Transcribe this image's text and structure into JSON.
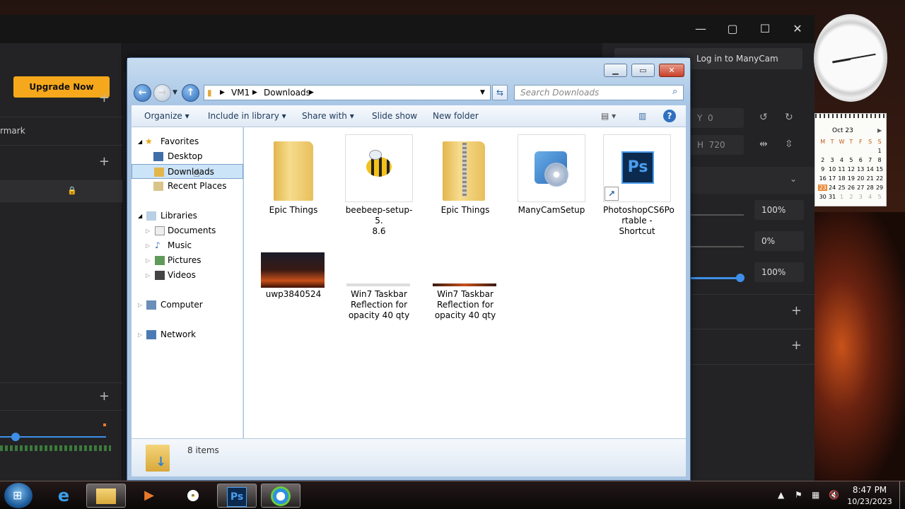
{
  "manycam": {
    "upgrade_label": "Upgrade Now",
    "left_partial_label": "rmark",
    "login_label": "Log in to ManyCam",
    "field_x": "0",
    "field_h": "720",
    "field_top": "720",
    "pct_1": "100%",
    "pct_2": "0%",
    "pct_3": "100%",
    "field_x_letter": "Y",
    "field_h_letter": "H",
    "plus": "+",
    "minimize": "—",
    "restore": "▢",
    "maximize": "☐",
    "close": "✕"
  },
  "explorer": {
    "breadcrumb": [
      "VM1",
      "Downloads"
    ],
    "search_placeholder": "Search Downloads",
    "commands": [
      "Organize",
      "Include in library",
      "Share with",
      "Slide show",
      "New folder"
    ],
    "nav": {
      "favorites": "Favorites",
      "desktop": "Desktop",
      "downloads": "Downloads",
      "recent": "Recent Places",
      "libraries": "Libraries",
      "documents": "Documents",
      "music": "Music",
      "pictures": "Pictures",
      "videos": "Videos",
      "computer": "Computer",
      "network": "Network"
    },
    "files": [
      {
        "name": "Epic Things",
        "icon": "folder-icon"
      },
      {
        "name": "beebeep-setup-5.\n8.6",
        "icon": "bee-icon"
      },
      {
        "name": "Epic Things",
        "icon": "zip-folder-icon"
      },
      {
        "name": "ManyCamSetup",
        "icon": "installer-icon"
      },
      {
        "name": "PhotoshopCS6Po\nrtable - Shortcut",
        "icon": "photoshop-icon"
      },
      {
        "name": "uwp3840524",
        "icon": "image-thumbnail-icon"
      },
      {
        "name": "Win7 Taskbar\nReflection for\nopacity 40 qty",
        "icon": "image-thumbnail-icon"
      },
      {
        "name": "Win7 Taskbar\nReflection for\nopacity 40 qty",
        "icon": "image-thumbnail-icon"
      }
    ],
    "item_count": "8 items"
  },
  "calendar": {
    "month": "Oct 23",
    "weekdays": [
      "M",
      "T",
      "W",
      "T",
      "F",
      "S",
      "S"
    ],
    "weeks": [
      [
        "",
        "",
        "",
        "",
        "",
        "",
        "1"
      ],
      [
        "2",
        "3",
        "4",
        "5",
        "6",
        "7",
        "8"
      ],
      [
        "9",
        "10",
        "11",
        "12",
        "13",
        "14",
        "15"
      ],
      [
        "16",
        "17",
        "18",
        "19",
        "20",
        "21",
        "22"
      ],
      [
        "23",
        "24",
        "25",
        "26",
        "27",
        "28",
        "29"
      ],
      [
        "30",
        "31",
        "1",
        "2",
        "3",
        "4",
        "5"
      ]
    ]
  },
  "taskbar": {
    "time": "8:47 PM",
    "date": "10/23/2023",
    "ps_label": "Ps"
  },
  "colors": {
    "upgrade": "#f5a81b",
    "slider_accent": "#3d8fe8"
  }
}
